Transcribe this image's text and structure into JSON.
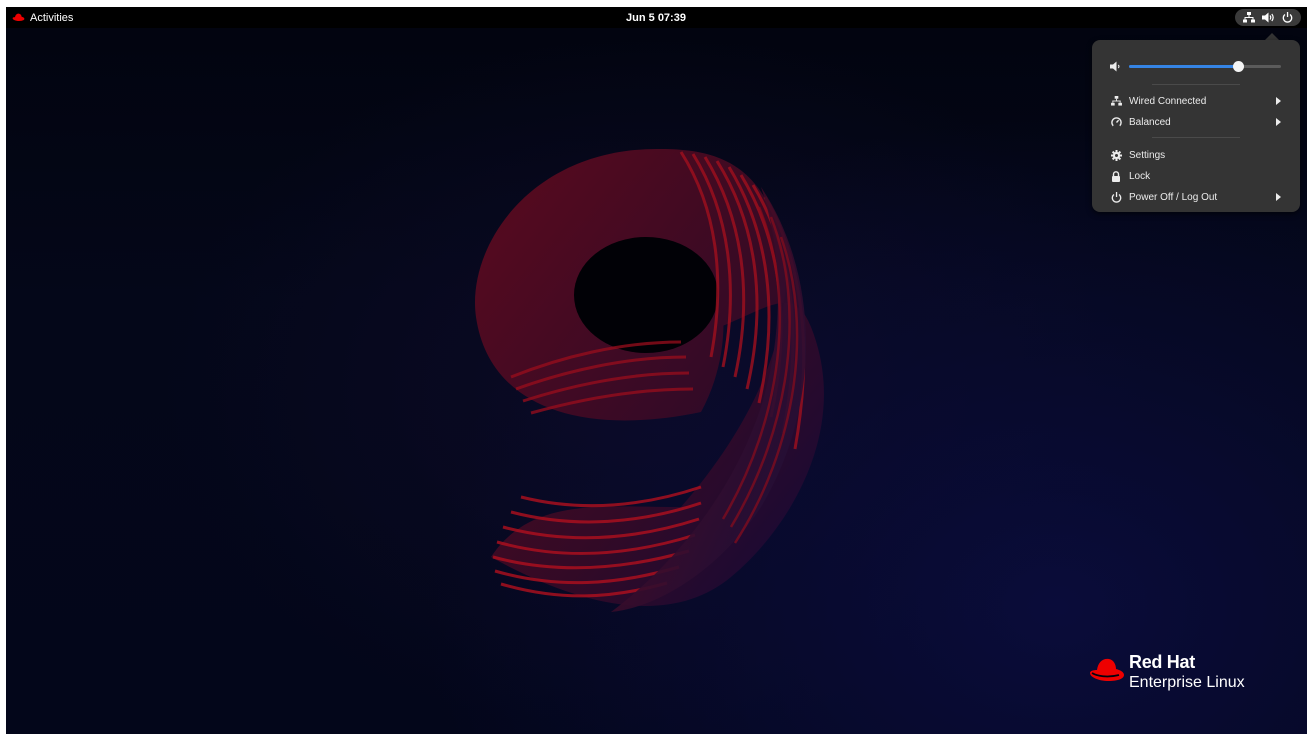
{
  "topbar": {
    "activities_label": "Activities",
    "clock": "Jun 5  07:39",
    "status_icons": [
      "network-wired-icon",
      "volume-icon",
      "power-icon"
    ]
  },
  "menu": {
    "volume": {
      "icon": "speaker-icon",
      "level": 0.72
    },
    "items": [
      {
        "icon": "network-wired-icon",
        "label": "Wired Connected",
        "submenu": true
      },
      {
        "icon": "power-profile-icon",
        "label": "Balanced",
        "submenu": true
      },
      {
        "icon": "gear-icon",
        "label": "Settings",
        "submenu": false
      },
      {
        "icon": "lock-icon",
        "label": "Lock",
        "submenu": false
      },
      {
        "icon": "power-icon",
        "label": "Power Off / Log Out",
        "submenu": true
      }
    ]
  },
  "wallpaper": {
    "brand_title": "Red Hat",
    "brand_subtitle": "Enterprise Linux",
    "colors": {
      "brand_red": "#ee0000",
      "accent_blue": "#3584e4",
      "menu_bg": "#343434"
    }
  }
}
